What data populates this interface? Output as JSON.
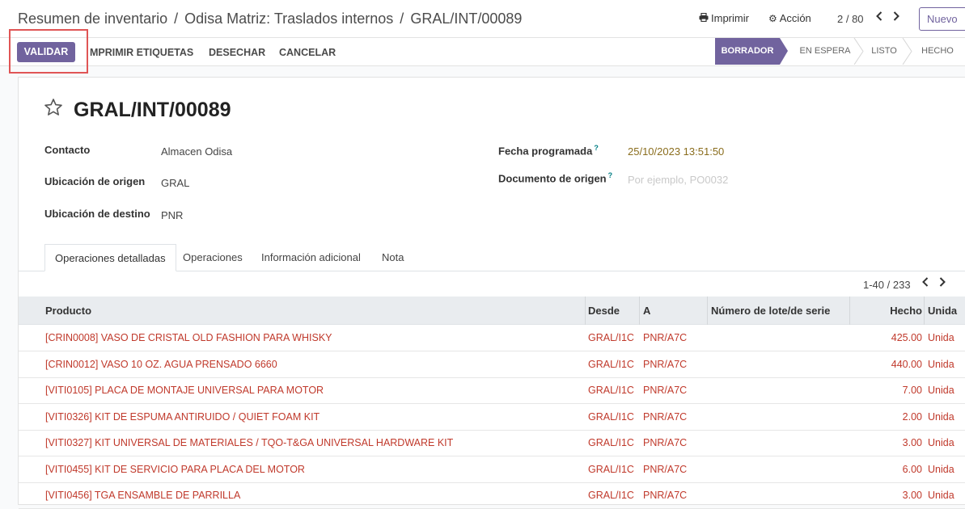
{
  "breadcrumb": {
    "items": [
      "Resumen de inventario",
      "Odisa Matriz: Traslados internos"
    ],
    "current": "GRAL/INT/00089",
    "separator": "/"
  },
  "toolbar": {
    "print_label": "Imprimir",
    "print_icon": "print-icon",
    "action_label": "Acción",
    "action_icon": "gear-icon",
    "pager": "2 / 80",
    "new_label": "Nuevo"
  },
  "actions": {
    "validate": "VALIDAR",
    "print_labels": "MPRIMIR ETIQUETAS",
    "discard": "DESECHAR",
    "cancel": "CANCELAR"
  },
  "statusbar": {
    "stages": [
      "BORRADOR",
      "EN ESPERA",
      "LISTO",
      "HECHO"
    ],
    "active": "BORRADOR"
  },
  "record": {
    "name": "GRAL/INT/00089",
    "contact_label": "Contacto",
    "contact_value": "Almacen Odisa",
    "origin_label": "Ubicación de origen",
    "origin_value": "GRAL",
    "dest_label": "Ubicación de destino",
    "dest_value": "PNR",
    "date_label": "Fecha programada",
    "date_value": "25/10/2023 13:51:50",
    "source_doc_label": "Documento de origen",
    "source_doc_placeholder": "Por ejemplo, PO0032",
    "help_mark": "?"
  },
  "tabs": [
    "Operaciones detalladas",
    "Operaciones",
    "Información adicional",
    "Nota"
  ],
  "list": {
    "pager": "1-40 / 233",
    "headers": [
      "Producto",
      "Desde",
      "A",
      "Número de lote/de serie",
      "Hecho",
      "Unida"
    ],
    "rows": [
      {
        "product": "[CRIN0008] VASO DE CRISTAL OLD FASHION PARA WHISKY",
        "from": "GRAL/I1C",
        "to": "PNR/A7C",
        "lot": "",
        "done": "425.00",
        "uom": "Unida"
      },
      {
        "product": "[CRIN0012] VASO 10 OZ. AGUA PRENSADO 6660",
        "from": "GRAL/I1C",
        "to": "PNR/A7C",
        "lot": "",
        "done": "440.00",
        "uom": "Unida"
      },
      {
        "product": "[VITI0105] PLACA DE MONTAJE UNIVERSAL PARA MOTOR",
        "from": "GRAL/I1C",
        "to": "PNR/A7C",
        "lot": "",
        "done": "7.00",
        "uom": "Unida"
      },
      {
        "product": "[VITI0326] KIT DE ESPUMA ANTIRUIDO / QUIET FOAM KIT",
        "from": "GRAL/I1C",
        "to": "PNR/A7C",
        "lot": "",
        "done": "2.00",
        "uom": "Unida"
      },
      {
        "product": "[VITI0327] KIT UNIVERSAL DE MATERIALES / TQO-T&GA UNIVERSAL HARDWARE KIT",
        "from": "GRAL/I1C",
        "to": "PNR/A7C",
        "lot": "",
        "done": "3.00",
        "uom": "Unida"
      },
      {
        "product": "[VITI0455] KIT DE SERVICIO PARA PLACA DEL MOTOR",
        "from": "GRAL/I1C",
        "to": "PNR/A7C",
        "lot": "",
        "done": "6.00",
        "uom": "Unida"
      },
      {
        "product": "[VITI0456] TGA ENSAMBLE DE PARRILLA",
        "from": "GRAL/I1C",
        "to": "PNR/A7C",
        "lot": "",
        "done": "3.00",
        "uom": "Unida"
      }
    ]
  },
  "colors": {
    "primary": "#71639e",
    "row_text": "#c0392b",
    "highlight": "#e05555"
  }
}
